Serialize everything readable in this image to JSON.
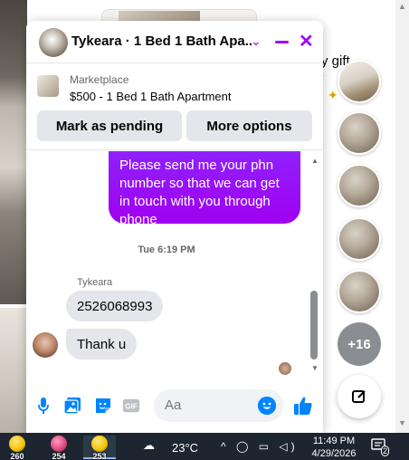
{
  "background": {
    "partial_text_line1": "ry gift",
    "partial_text_line2": "y"
  },
  "chat": {
    "header": {
      "title": "Tykeara · 1 Bed 1 Bath Apa...",
      "accent": "#a100ff"
    },
    "marketplace": {
      "category": "Marketplace",
      "listing": "$500 - 1 Bed 1 Bath Apartment",
      "mark_pending_label": "Mark as pending",
      "more_options_label": "More options"
    },
    "messages": {
      "outgoing_text": "Please send me your phn number so that we can get in touch with you through phone",
      "timestamp": "Tue 6:19 PM",
      "sender_name": "Tykeara",
      "incoming": [
        "2526068993",
        "Thank u"
      ]
    },
    "composer": {
      "placeholder": "Aa",
      "icons": [
        "microphone-icon",
        "photo-icon",
        "sticker-icon",
        "gif-icon",
        "emoji-icon",
        "thumbs-up-icon"
      ]
    }
  },
  "sidebar": {
    "more_count": "+16"
  },
  "taskbar": {
    "apps": [
      {
        "badge": "260",
        "color": "#f2c200"
      },
      {
        "badge": "254",
        "color": "#e0457b"
      },
      {
        "badge": "253",
        "color": "#f2c200"
      }
    ],
    "temperature": "23°C",
    "time": "11:49 PM",
    "date": "4/29/2026",
    "notification_count": "2"
  }
}
